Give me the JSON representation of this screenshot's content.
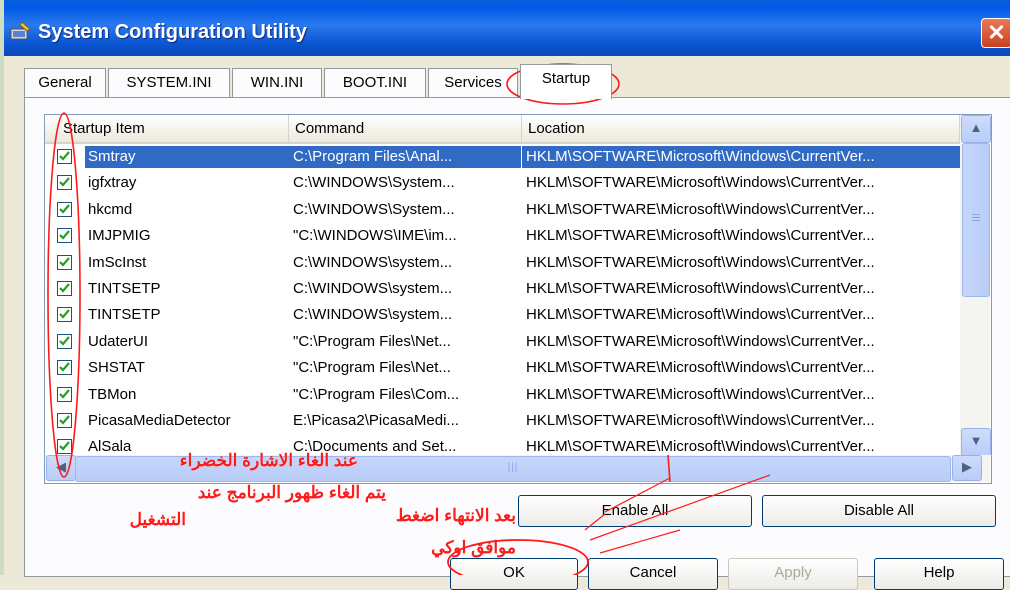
{
  "window": {
    "title": "System Configuration Utility",
    "close_glyph": "✕",
    "icon": "msconfig-icon"
  },
  "tabs": [
    {
      "label": "General",
      "active": false
    },
    {
      "label": "SYSTEM.INI",
      "active": false
    },
    {
      "label": "WIN.INI",
      "active": false
    },
    {
      "label": "BOOT.INI",
      "active": false
    },
    {
      "label": "Services",
      "active": false
    },
    {
      "label": "Startup",
      "active": true
    }
  ],
  "list": {
    "columns": [
      "Startup Item",
      "Command",
      "Location"
    ],
    "rows": [
      {
        "checked": true,
        "item": "Smtray",
        "command": "C:\\Program Files\\Anal...",
        "location": "HKLM\\SOFTWARE\\Microsoft\\Windows\\CurrentVer...",
        "selected": true
      },
      {
        "checked": true,
        "item": "igfxtray",
        "command": "C:\\WINDOWS\\System...",
        "location": "HKLM\\SOFTWARE\\Microsoft\\Windows\\CurrentVer..."
      },
      {
        "checked": true,
        "item": "hkcmd",
        "command": "C:\\WINDOWS\\System...",
        "location": "HKLM\\SOFTWARE\\Microsoft\\Windows\\CurrentVer..."
      },
      {
        "checked": true,
        "item": "IMJPMIG",
        "command": "\"C:\\WINDOWS\\IME\\im...",
        "location": "HKLM\\SOFTWARE\\Microsoft\\Windows\\CurrentVer..."
      },
      {
        "checked": true,
        "item": "ImScInst",
        "command": "C:\\WINDOWS\\system...",
        "location": "HKLM\\SOFTWARE\\Microsoft\\Windows\\CurrentVer..."
      },
      {
        "checked": true,
        "item": "TINTSETP",
        "command": "C:\\WINDOWS\\system...",
        "location": "HKLM\\SOFTWARE\\Microsoft\\Windows\\CurrentVer..."
      },
      {
        "checked": true,
        "item": "TINTSETP",
        "command": "C:\\WINDOWS\\system...",
        "location": "HKLM\\SOFTWARE\\Microsoft\\Windows\\CurrentVer..."
      },
      {
        "checked": true,
        "item": "UdaterUI",
        "command": "\"C:\\Program Files\\Net...",
        "location": "HKLM\\SOFTWARE\\Microsoft\\Windows\\CurrentVer..."
      },
      {
        "checked": true,
        "item": "SHSTAT",
        "command": "\"C:\\Program Files\\Net...",
        "location": "HKLM\\SOFTWARE\\Microsoft\\Windows\\CurrentVer..."
      },
      {
        "checked": true,
        "item": "TBMon",
        "command": "\"C:\\Program Files\\Com...",
        "location": "HKLM\\SOFTWARE\\Microsoft\\Windows\\CurrentVer..."
      },
      {
        "checked": true,
        "item": "PicasaMediaDetector",
        "command": "E:\\Picasa2\\PicasaMedi...",
        "location": "HKLM\\SOFTWARE\\Microsoft\\Windows\\CurrentVer..."
      },
      {
        "checked": true,
        "item": "AlSala",
        "command": "C:\\Documents and Set...",
        "location": "HKLM\\SOFTWARE\\Microsoft\\Windows\\CurrentVer..."
      }
    ]
  },
  "scrollbar": {
    "up": "▲",
    "down": "▼",
    "left": "◀",
    "right": "▶",
    "hgrip": "|||"
  },
  "buttons": {
    "enable_all": "Enable All",
    "disable_all": "Disable All",
    "ok": "OK",
    "cancel": "Cancel",
    "apply": "Apply",
    "help": "Help"
  },
  "annotations": {
    "line1": "عند الغاء الاشارة الخضراء",
    "line2": "يتم الغاء ظهور البرنامج عند",
    "line3": "التشغيل",
    "line4": "بعد الانتهاء اضغط",
    "line5": "موافق اوكي"
  },
  "colors": {
    "annotation": "#ff1a1a",
    "selection": "#316ac5",
    "titlebar": "#0058e6"
  }
}
